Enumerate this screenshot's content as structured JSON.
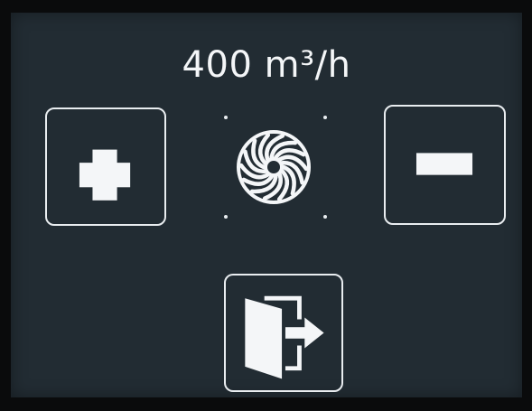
{
  "display": {
    "flow_rate": "400 m³/h"
  },
  "controls": {
    "increase": {
      "icon": "plus-icon"
    },
    "decrease": {
      "icon": "minus-icon"
    },
    "exit": {
      "icon": "exit-door-icon"
    }
  },
  "status": {
    "fan_icon": "fan-icon"
  },
  "colors": {
    "screen_background": "#222c33",
    "foreground": "#f4f6f8",
    "bezel": "#0a0b0c"
  }
}
